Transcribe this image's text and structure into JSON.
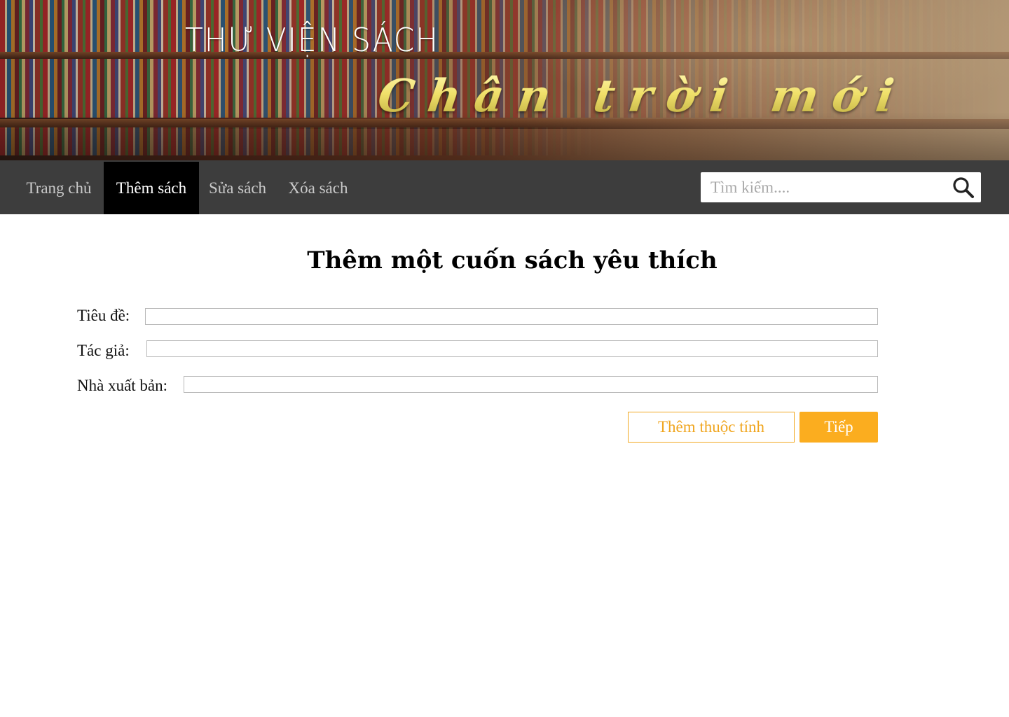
{
  "header": {
    "site_title": "THƯ VIỆN SÁCH",
    "slogan": "Chân trời mới"
  },
  "nav": {
    "items": [
      {
        "label": "Trang chủ",
        "active": false
      },
      {
        "label": "Thêm sách",
        "active": true
      },
      {
        "label": "Sửa sách",
        "active": false
      },
      {
        "label": "Xóa sách",
        "active": false
      }
    ],
    "search": {
      "placeholder": "Tìm kiếm....",
      "value": "",
      "icon": "search-icon"
    }
  },
  "main": {
    "title": "Thêm một cuốn sách yêu thích",
    "fields": [
      {
        "label": "Tiêu đề:",
        "value": ""
      },
      {
        "label": "Tác giả:",
        "value": ""
      },
      {
        "label": "Nhà xuất bản:",
        "value": ""
      }
    ],
    "buttons": {
      "add_attribute": "Thêm thuộc tính",
      "next": "Tiếp"
    }
  },
  "colors": {
    "nav_background": "#3d3d3d",
    "nav_active": "#000000",
    "accent": "#fbad1f",
    "slogan_gold": "#e6e070"
  }
}
